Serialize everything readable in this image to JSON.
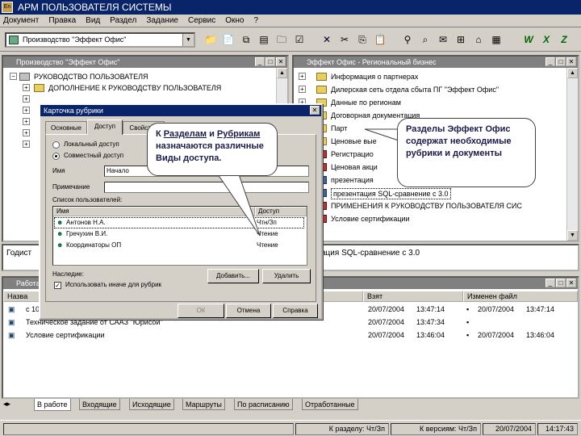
{
  "app": {
    "title": "АРМ ПОЛЬЗОВАТЕЛЯ СИСТЕМЫ",
    "icon_label": "En"
  },
  "menu": [
    "Документ",
    "Правка",
    "Вид",
    "Раздел",
    "Задание",
    "Сервис",
    "Окно",
    "?"
  ],
  "toolbar": {
    "combo_value": "Производство \"Эффект Офис\""
  },
  "left_panel": {
    "title": "Производство \"Эффект Офис\"",
    "tree": [
      "РУКОВОДСТВО ПОЛЬЗОВАТЕЛЯ",
      "ДОПОЛНЕНИЕ К РУКОВОДСТВУ ПОЛЬЗОВАТЕЛЯ"
    ],
    "status_text": "Годист"
  },
  "right_panel": {
    "title": "Эффект Офис - Региональный бизнес",
    "tree": [
      "Информация о партнерах",
      "Дилерская сеть отдела сбыта ПГ \"Эффект Офис\"",
      "Данные по регионам",
      "Договорная документация",
      "Парт",
      "Ценовые вые",
      "Регистрацио",
      "Ценовая акци",
      "презентация",
      "презентация SQL-сравнение с 3.0",
      "ПРИМЕНЕНИЯ К РУКОВОДСТВУ ПОЛЬЗОВАТЕЛЯ СИС",
      "Условие сертификации"
    ],
    "status_text": "ация SQL-сравнение с 3.0"
  },
  "dialog": {
    "title": "Карточка рубрики",
    "tabs": [
      "Основные",
      "Доступ",
      "Свойства"
    ],
    "radio_local": "Локальный доступ",
    "radio_shared": "Совместный доступ",
    "name_label": "Имя",
    "name_value": "Начало",
    "note_label": "Примечание",
    "users_label": "Список пользователей:",
    "col_name": "Имя",
    "col_access": "Доступ",
    "users": [
      {
        "name": "Антонов Н.А.",
        "access": "Чтн/Зп"
      },
      {
        "name": "Гречухин В.И.",
        "access": "Чтение"
      },
      {
        "name": "Координаторы ОП",
        "access": "Чтение"
      }
    ],
    "inherit_label": "Наследие:",
    "inherit_checkbox": "Использовать иначе для рубрик",
    "add_button": "Добавить...",
    "delete_button": "Удалить",
    "ok_button": "ОК",
    "cancel_button": "Отмена",
    "help_button": "Справка"
  },
  "callout_left": {
    "p1": "К ",
    "link1": "Разделам",
    "p2": " и ",
    "link2": "Рубрикам",
    "p3": " назначаются различные Виды доступа."
  },
  "callout_right": {
    "text": "Разделы Эффект Офис содержат необходимые рубрики и документы"
  },
  "work_list": {
    "title": "Работа",
    "columns": [
      "Назва",
      "Взят",
      "Изменен файл"
    ],
    "rows": [
      {
        "name": "с 10",
        "taken": "20/07/2004",
        "taken_time": "13:47:14",
        "changed": "20/07/2004",
        "changed_time": "13:47:14"
      },
      {
        "name": "Техническое задание от СААЗ \"Юрисой\"",
        "taken": "20/07/2004",
        "taken_time": "13:47:34",
        "changed": "",
        "changed_time": ""
      },
      {
        "name": "Условие сертификации",
        "taken": "20/07/2004",
        "taken_time": "13:46:04",
        "changed": "20/07/2004",
        "changed_time": "13:46:04"
      }
    ]
  },
  "bottom_tabs": [
    "В работе",
    "Входящие",
    "Исходящие",
    "Маршруты",
    "По расписанию",
    "Отработанные"
  ],
  "statusbar": {
    "section": "К разделу: Чт/Зп",
    "version": "К версиям: Чт/Зп",
    "date": "20/07/2004",
    "time": "14:17:43"
  }
}
